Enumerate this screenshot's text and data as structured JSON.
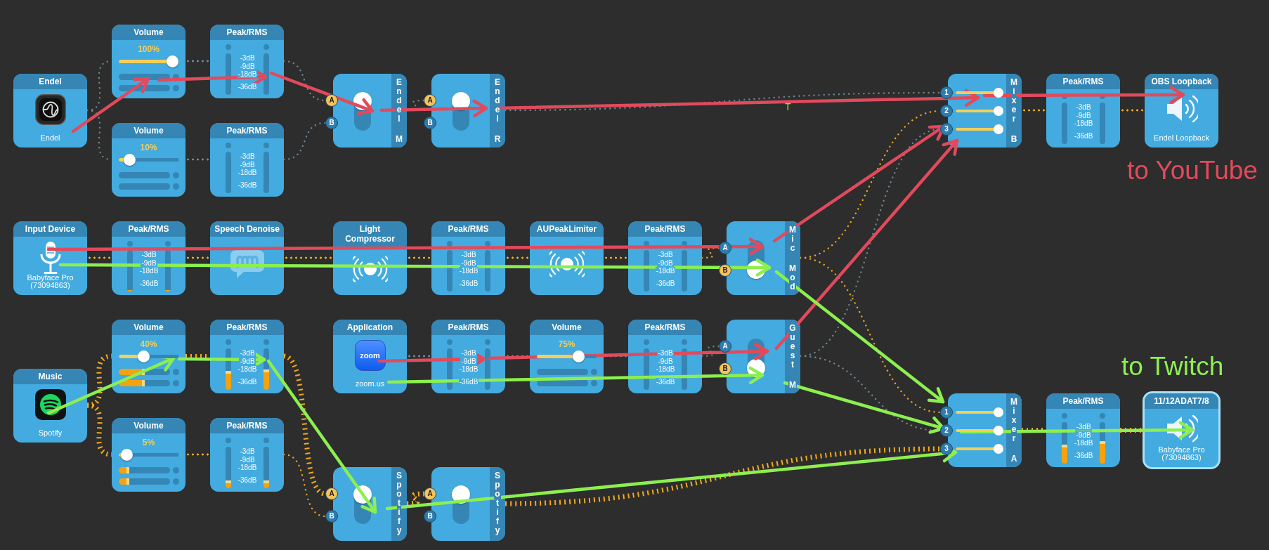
{
  "nodes": [
    {
      "kind": "source",
      "title": "Endel",
      "caption": "Endel",
      "output_active": false,
      "output_loud": false,
      "selected": false
    },
    {
      "kind": "volume",
      "title": "Volume",
      "reading": "100%",
      "level": 1,
      "output_active": false,
      "output_loud": false,
      "selected": false
    },
    {
      "kind": "meter",
      "title": "Peak/RMS",
      "scale": [
        "-3dB",
        "-9dB",
        "-18dB",
        "-36dB"
      ],
      "output_active": false,
      "output_loud": false,
      "selected": false
    },
    {
      "kind": "volume",
      "title": "Volume",
      "reading": "10%",
      "level": 0.1,
      "output_active": false,
      "output_loud": false,
      "selected": false
    },
    {
      "kind": "meter",
      "title": "Peak/RMS",
      "scale": [
        "-3dB",
        "-9dB",
        "-18dB",
        "-36dB"
      ],
      "output_active": false,
      "output_loud": false,
      "selected": false
    },
    {
      "kind": "switch",
      "label": "Endel M",
      "ports": [
        {
          "label": "A",
          "selected": true
        },
        {
          "label": "B",
          "selected": false
        }
      ],
      "output_active": false,
      "output_loud": false,
      "selected": false
    },
    {
      "kind": "switch",
      "label": "Endel R",
      "ports": [
        {
          "label": "A",
          "selected": true
        },
        {
          "label": "B",
          "selected": false
        }
      ],
      "output_active": false,
      "output_loud": false,
      "selected": false
    },
    {
      "kind": "mixer",
      "label": "Mixer B",
      "inputs": [
        {
          "label": "1",
          "level": 1
        },
        {
          "label": "2",
          "level": 1
        },
        {
          "label": "3",
          "level": 1
        }
      ],
      "output_active": true,
      "output_loud": false,
      "selected": false
    },
    {
      "kind": "meter",
      "title": "Peak/RMS",
      "scale": [
        "-3dB",
        "-9dB",
        "-18dB",
        "-36dB"
      ],
      "output_active": true,
      "output_loud": false,
      "selected": false
    },
    {
      "kind": "output",
      "title": "OBS Loopback",
      "caption": "Endel Loopback",
      "selected": false
    },
    {
      "kind": "source",
      "title": "Input Device",
      "caption": "Babyface Pro (73094863)",
      "output_active": true,
      "output_loud": false,
      "selected": false
    },
    {
      "kind": "meter",
      "title": "Peak/RMS",
      "scale": [
        "-3dB",
        "-9dB",
        "-18dB",
        "-36dB"
      ],
      "meters": [
        {
          "level": 0.04
        },
        {
          "level": 0.04
        }
      ],
      "output_active": true,
      "output_loud": false,
      "selected": false
    },
    {
      "kind": "effect",
      "title": "Speech Denoise",
      "output_active": true,
      "output_loud": false,
      "selected": false
    },
    {
      "kind": "effect",
      "title": "Light Compressor",
      "output_active": true,
      "output_loud": false,
      "selected": false
    },
    {
      "kind": "meter",
      "title": "Peak/RMS",
      "scale": [
        "-3dB",
        "-9dB",
        "-18dB",
        "-36dB"
      ],
      "output_active": true,
      "output_loud": false,
      "selected": false
    },
    {
      "kind": "effect",
      "title": "AUPeakLimiter",
      "output_active": true,
      "output_loud": false,
      "selected": false
    },
    {
      "kind": "meter",
      "title": "Peak/RMS",
      "scale": [
        "-3dB",
        "-9dB",
        "-18dB",
        "-36dB"
      ],
      "output_active": true,
      "output_loud": false,
      "selected": false
    },
    {
      "kind": "switch",
      "label": "Mic Mod",
      "ports": [
        {
          "label": "A",
          "selected": false
        },
        {
          "label": "B",
          "selected": true
        }
      ],
      "output_active": true,
      "output_loud": false,
      "selected": false
    },
    {
      "kind": "volume",
      "title": "Volume",
      "reading": "40%",
      "level": 0.4,
      "meters": [
        {
          "level": 0.5
        },
        {
          "level": 0.5
        }
      ],
      "output_active": true,
      "output_loud": true,
      "selected": false
    },
    {
      "kind": "meter",
      "title": "Peak/RMS",
      "scale": [
        "-3dB",
        "-9dB",
        "-18dB",
        "-36dB"
      ],
      "meters": [
        {
          "level": 0.45
        },
        {
          "level": 0.5
        }
      ],
      "output_active": true,
      "output_loud": true,
      "selected": false
    },
    {
      "kind": "source",
      "title": "Application",
      "logo_text": "zoom",
      "caption": "zoom.us",
      "output_active": false,
      "output_loud": false,
      "selected": false
    },
    {
      "kind": "meter",
      "title": "Peak/RMS",
      "scale": [
        "-3dB",
        "-9dB",
        "-18dB",
        "-36dB"
      ],
      "output_active": false,
      "output_loud": false,
      "selected": false
    },
    {
      "kind": "volume",
      "title": "Volume",
      "reading": "75%",
      "level": 0.75,
      "output_active": false,
      "output_loud": false,
      "selected": false
    },
    {
      "kind": "meter",
      "title": "Peak/RMS",
      "scale": [
        "-3dB",
        "-9dB",
        "-18dB",
        "-36dB"
      ],
      "output_active": false,
      "output_loud": false,
      "selected": false
    },
    {
      "kind": "switch",
      "label": "Guest M",
      "ports": [
        {
          "label": "A",
          "selected": false
        },
        {
          "label": "B",
          "selected": true
        }
      ],
      "output_active": false,
      "output_loud": false,
      "selected": false
    },
    {
      "kind": "source",
      "title": "Music",
      "caption": "Spotify",
      "output_active": true,
      "output_loud": true,
      "selected": false
    },
    {
      "kind": "volume",
      "title": "Volume",
      "reading": "5%",
      "level": 0.05,
      "meters": [
        {
          "level": 0.2
        },
        {
          "level": 0.2
        }
      ],
      "output_active": true,
      "output_loud": false,
      "selected": false
    },
    {
      "kind": "meter",
      "title": "Peak/RMS",
      "scale": [
        "-3dB",
        "-9dB",
        "-18dB",
        "-36dB"
      ],
      "meters": [
        {
          "level": 0.18
        },
        {
          "level": 0.18
        }
      ],
      "output_active": true,
      "output_loud": false,
      "selected": false
    },
    {
      "kind": "switch",
      "label": "Spotify",
      "ports": [
        {
          "label": "A",
          "selected": true
        },
        {
          "label": "B",
          "selected": false
        }
      ],
      "output_active": true,
      "output_loud": true,
      "selected": false
    },
    {
      "kind": "switch",
      "label": "Spotify",
      "ports": [
        {
          "label": "A",
          "selected": true
        },
        {
          "label": "B",
          "selected": false
        }
      ],
      "output_active": true,
      "output_loud": true,
      "selected": false
    },
    {
      "kind": "mixer",
      "label": "Mixer A",
      "inputs": [
        {
          "label": "1",
          "level": 1
        },
        {
          "label": "2",
          "level": 1
        },
        {
          "label": "3",
          "level": 1
        }
      ],
      "output_active": true,
      "output_loud": true,
      "selected": false
    },
    {
      "kind": "meter",
      "title": "Peak/RMS",
      "scale": [
        "-3dB",
        "-9dB",
        "-18dB",
        "-36dB"
      ],
      "meters": [
        {
          "level": 0.45
        },
        {
          "level": 0.55
        }
      ],
      "output_active": true,
      "output_loud": true,
      "selected": false
    },
    {
      "kind": "output",
      "title": "11/12ADAT7/8",
      "caption": "Babyface Pro (73094863)",
      "selected": true
    }
  ],
  "routes": [
    {
      "label": "to YouTube",
      "color": "#e24a5c"
    },
    {
      "label": "to Twitch",
      "color": "#8def4f",
      "note": "T"
    }
  ]
}
